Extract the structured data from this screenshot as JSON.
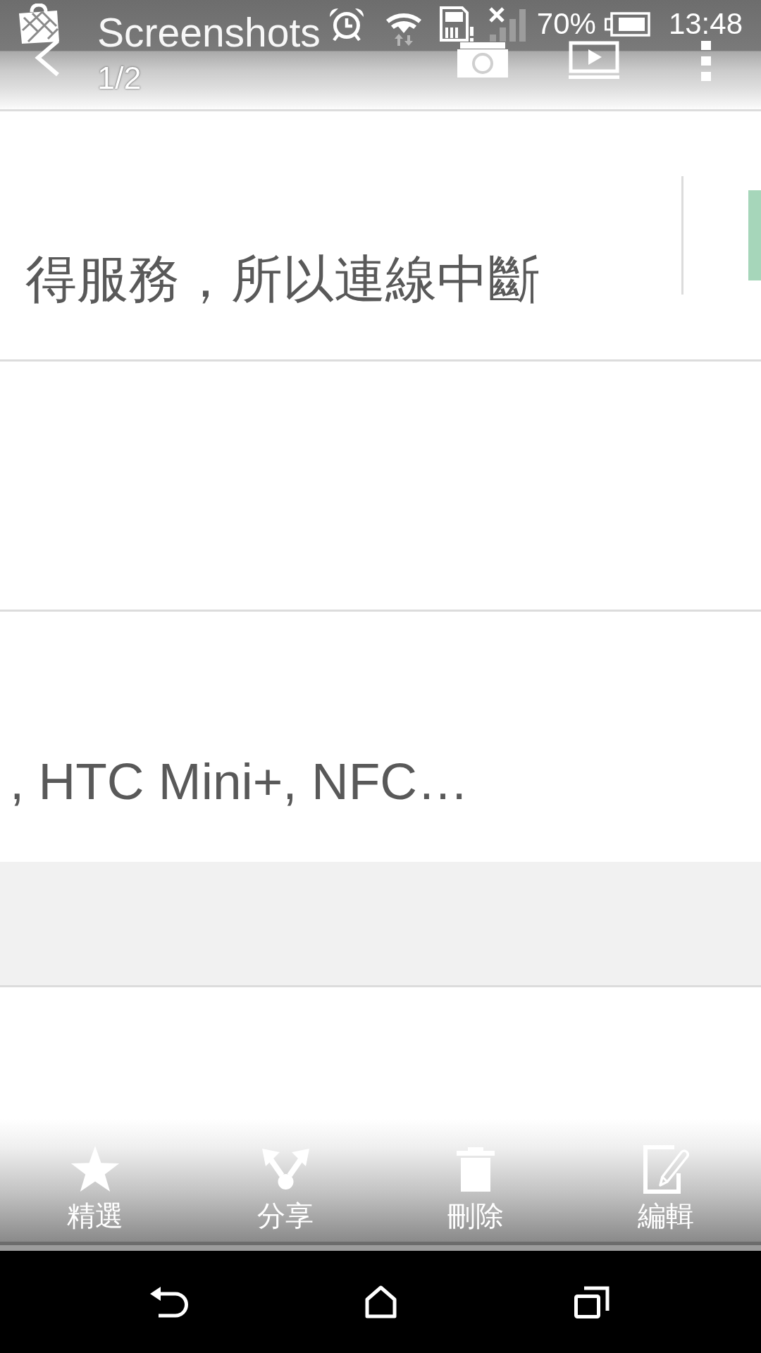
{
  "status_bar": {
    "battery": "70%",
    "time": "13:48"
  },
  "app_bar": {
    "title": "Screenshots",
    "counter": "1/2"
  },
  "image": {
    "rows": [
      {
        "kind": "toggle",
        "summary": "得服務，所以連線中斷",
        "on": true
      },
      {
        "kind": "blank"
      },
      {
        "kind": "summary",
        "summary": ", HTC Mini+, NFC…"
      }
    ]
  },
  "actions": [
    {
      "label": "精選"
    },
    {
      "label": "分享"
    },
    {
      "label": "刪除"
    },
    {
      "label": "編輯"
    }
  ]
}
